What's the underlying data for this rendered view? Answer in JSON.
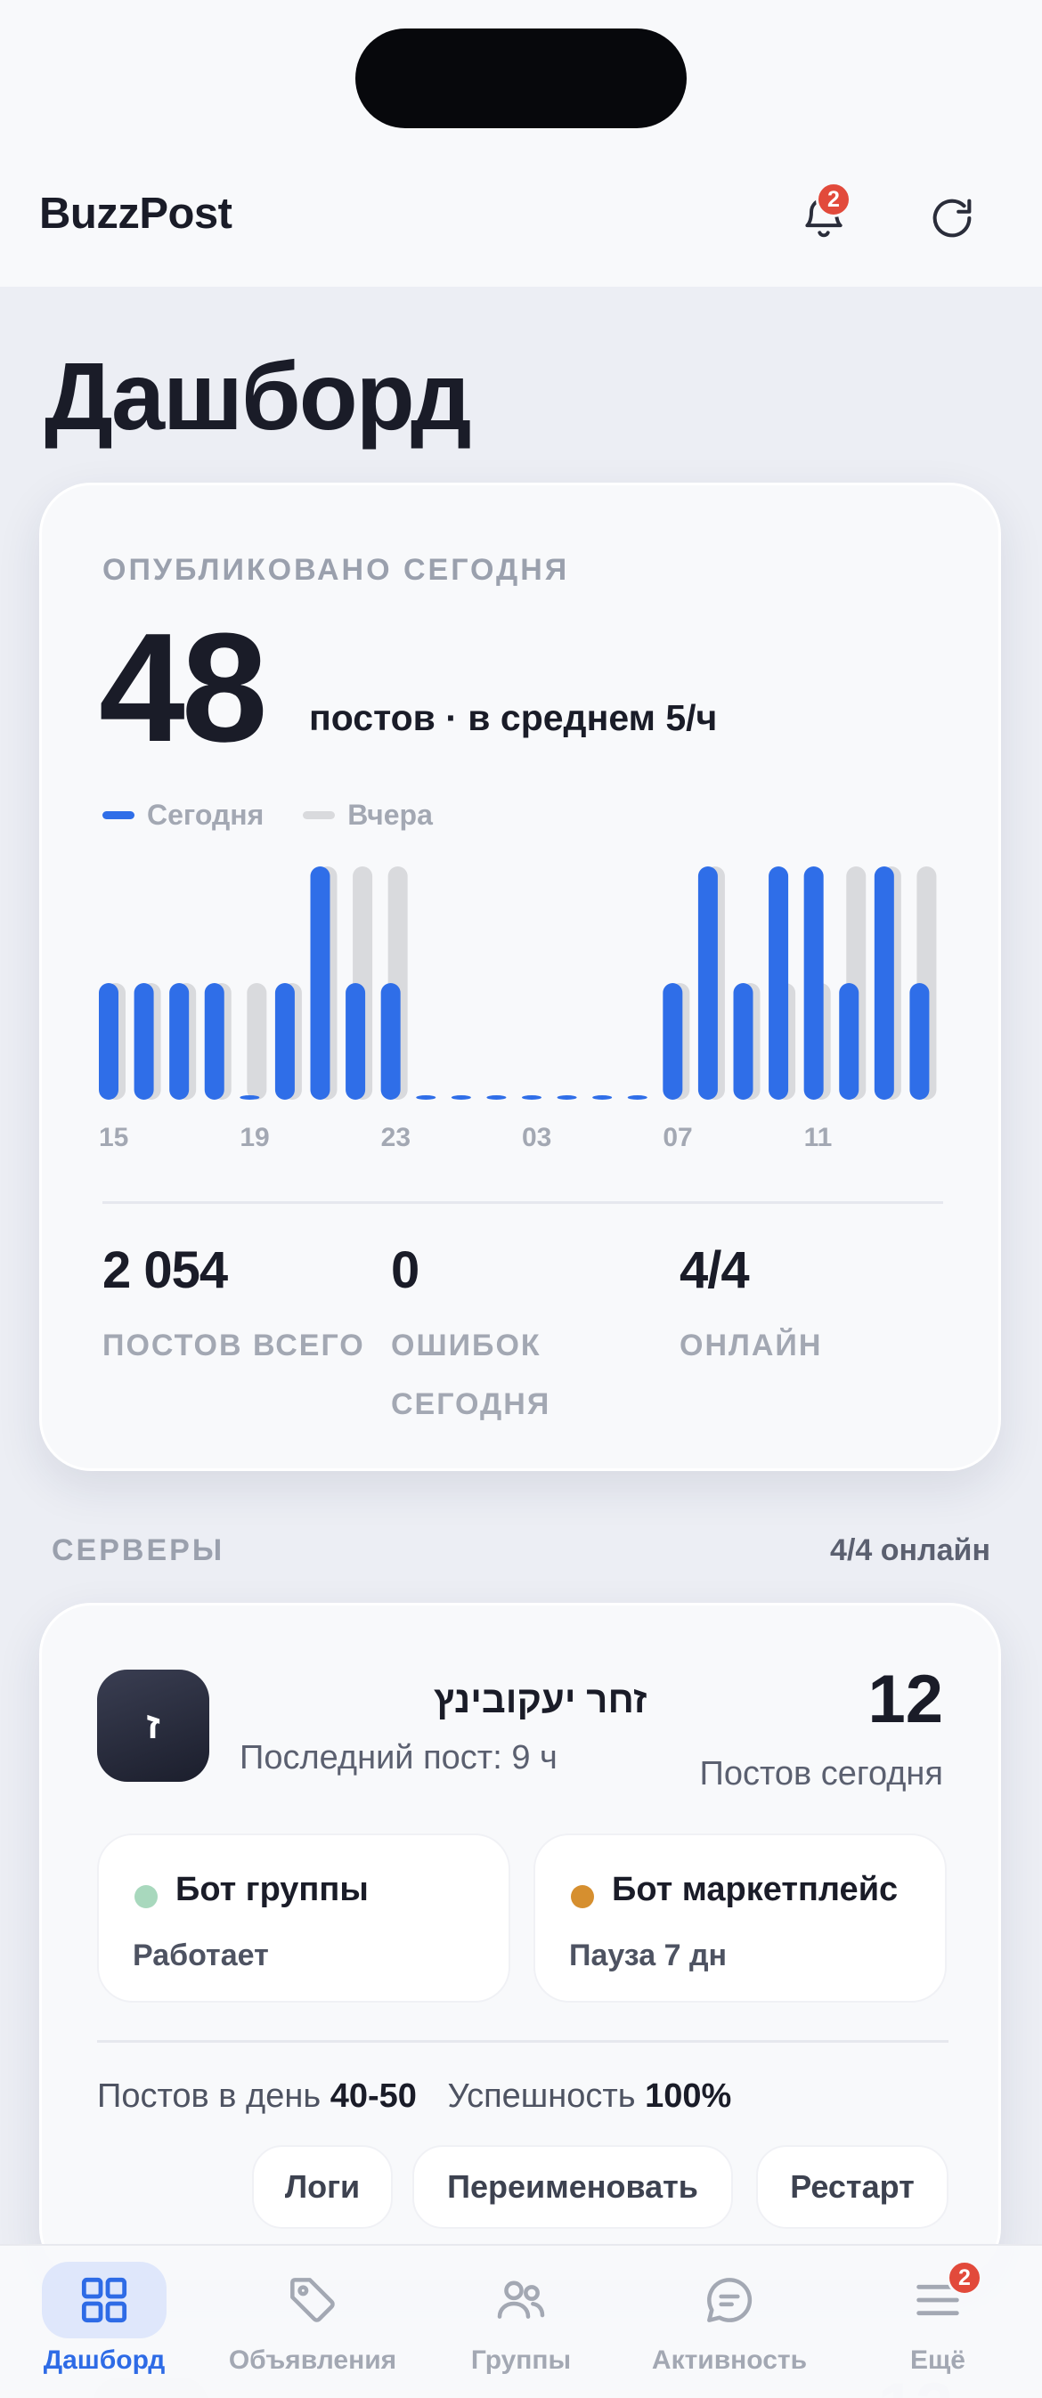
{
  "app": {
    "brand": "BuzzPost",
    "notifications_badge": "2"
  },
  "page": {
    "title": "Дашборд"
  },
  "summary": {
    "kicker": "ОПУБЛИКОВАНО СЕГОДНЯ",
    "count": "48",
    "sub_prefix": "постов · в среднем ",
    "sub_rate": "5/ч",
    "stats": [
      {
        "value": "2 054",
        "label": "ПОСТОВ ВСЕГО"
      },
      {
        "value": "0",
        "label": "ОШИБОК СЕГОДНЯ"
      },
      {
        "value": "4/4",
        "label": "ОНЛАЙН"
      }
    ]
  },
  "chart_data": {
    "type": "bar",
    "categories": [
      "15",
      "16",
      "17",
      "18",
      "19",
      "20",
      "21",
      "22",
      "23",
      "00",
      "01",
      "02",
      "03",
      "04",
      "05",
      "06",
      "07",
      "08",
      "09",
      "10",
      "11",
      "12",
      "13",
      "14"
    ],
    "tick_labels": [
      "15",
      "19",
      "23",
      "03",
      "07",
      "11"
    ],
    "series": [
      {
        "name": "Сегодня",
        "values": [
          2,
          2,
          2,
          2,
          0,
          2,
          4,
          2,
          2,
          0,
          0,
          0,
          0,
          0,
          0,
          0,
          2,
          4,
          2,
          4,
          4,
          2,
          4,
          2
        ]
      },
      {
        "name": "Вчера",
        "values": [
          2,
          2,
          2,
          2,
          2,
          2,
          4,
          4,
          4,
          0,
          0,
          0,
          0,
          0,
          0,
          0,
          2,
          4,
          2,
          2,
          2,
          4,
          4,
          4
        ]
      }
    ],
    "ylim": [
      0,
      4
    ],
    "colors": {
      "today": "#2f6ee8",
      "yesterday": "#d9dadd",
      "zero_marker": "#2f6ee8"
    },
    "legend_position": "top-left",
    "grid": false
  },
  "servers": {
    "title": "СЕРВЕРЫ",
    "status": "4/4 онлайн",
    "items": [
      {
        "avatar_letter": "ז",
        "name": "זחר יעקובינץ",
        "last_post": "Последний пост: 9 ч",
        "posts_today": "12",
        "posts_today_label": "Постов сегодня",
        "bots": [
          {
            "title": "Бот группы",
            "status": "Работает",
            "color": "#a8d8bd"
          },
          {
            "title": "Бот маркетплейс",
            "status": "Пауза 7 дн",
            "color": "#d68f2f"
          }
        ],
        "per_day_label": "Постов в день",
        "per_day_value": "40-50",
        "success_label": "Успешность",
        "success_value": "100%",
        "actions": [
          "Логи",
          "Переименовать",
          "Рестарт"
        ]
      }
    ],
    "next_preview_count": "12"
  },
  "tabs": [
    {
      "label": "Дашборд",
      "icon": "grid-icon",
      "active": true
    },
    {
      "label": "Объявления",
      "icon": "tag-icon",
      "active": false
    },
    {
      "label": "Группы",
      "icon": "users-icon",
      "active": false
    },
    {
      "label": "Активность",
      "icon": "chat-icon",
      "active": false
    },
    {
      "label": "Ещё",
      "icon": "menu-icon",
      "active": false,
      "badge": "2"
    }
  ]
}
